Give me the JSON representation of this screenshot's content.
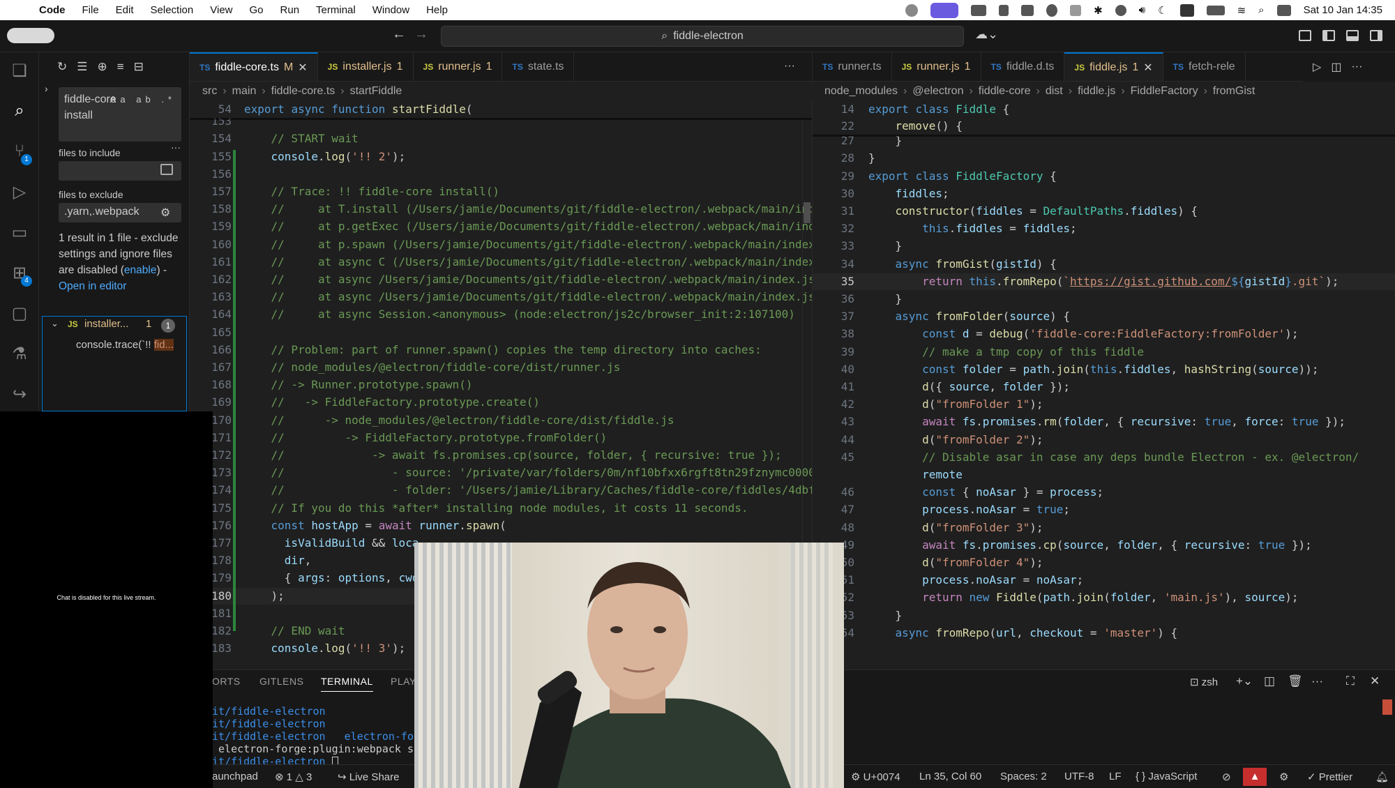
{
  "menubar": {
    "app": "Code",
    "items": [
      "File",
      "Edit",
      "Selection",
      "View",
      "Go",
      "Run",
      "Terminal",
      "Window",
      "Help"
    ],
    "datetime": "Sat 10 Jan  14:35"
  },
  "titlebar": {
    "search": "fiddle-electron"
  },
  "activity": {
    "scm_badge": "1",
    "ext_badge": "4"
  },
  "sidebar": {
    "search_value": "fiddle-core install",
    "search_opts": "Aa ab .*",
    "files_include_label": "files to include",
    "files_exclude_label": "files to exclude",
    "files_exclude_value": ".yarn,.webpack",
    "message": "1 result in 1 file - exclude settings and ignore files are disabled (",
    "message_link": "enable",
    "message_end": ") -",
    "open_in_editor": "Open in editor",
    "result_file": "installer...",
    "result_file_count_inline": "1",
    "result_count": "1",
    "match_prefix": "console.trace(`!! ",
    "match_hl": "fid..."
  },
  "left_editor": {
    "tabs": [
      {
        "icon": "TS",
        "label": "fiddle-core.ts",
        "suffix": "M",
        "active": true
      },
      {
        "icon": "JS",
        "label": "installer.js",
        "suffix": "1"
      },
      {
        "icon": "JS",
        "label": "runner.js",
        "suffix": "1"
      },
      {
        "icon": "TS",
        "label": "state.ts",
        "suffix": ""
      }
    ],
    "breadcrumb": [
      "src",
      "main",
      "fiddle-core.ts",
      "startFiddle"
    ],
    "sticky": {
      "num": "54",
      "text": "export async function startFiddle("
    },
    "lines": [
      {
        "n": "152",
        "t": "    });"
      },
      {
        "n": "153",
        "t": ""
      },
      {
        "n": "154",
        "t": "    // START wait"
      },
      {
        "n": "155",
        "t": "    console.log('!! 2');"
      },
      {
        "n": "156",
        "t": ""
      },
      {
        "n": "157",
        "t": "    // Trace: !! fiddle-core install()"
      },
      {
        "n": "158",
        "t": "    //     at T.install (/Users/jamie/Documents/git/fiddle-electron/.webpack/main/ind"
      },
      {
        "n": "159",
        "t": "    //     at p.getExec (/Users/jamie/Documents/git/fiddle-electron/.webpack/main/ind"
      },
      {
        "n": "160",
        "t": "    //     at p.spawn (/Users/jamie/Documents/git/fiddle-electron/.webpack/main/index"
      },
      {
        "n": "161",
        "t": "    //     at async C (/Users/jamie/Documents/git/fiddle-electron/.webpack/main/index"
      },
      {
        "n": "162",
        "t": "    //     at async /Users/jamie/Documents/git/fiddle-electron/.webpack/main/index.js"
      },
      {
        "n": "163",
        "t": "    //     at async /Users/jamie/Documents/git/fiddle-electron/.webpack/main/index.js"
      },
      {
        "n": "164",
        "t": "    //     at async Session.<anonymous> (node:electron/js2c/browser_init:2:107100)"
      },
      {
        "n": "165",
        "t": ""
      },
      {
        "n": "166",
        "t": "    // Problem: part of runner.spawn() copies the temp directory into caches:"
      },
      {
        "n": "167",
        "t": "    // node_modules/@electron/fiddle-core/dist/runner.js"
      },
      {
        "n": "168",
        "t": "    // -> Runner.prototype.spawn()"
      },
      {
        "n": "169",
        "t": "    //   -> FiddleFactory.prototype.create()"
      },
      {
        "n": "170",
        "t": "    //      -> node_modules/@electron/fiddle-core/dist/fiddle.js"
      },
      {
        "n": "171",
        "t": "    //         -> FiddleFactory.prototype.fromFolder()"
      },
      {
        "n": "172",
        "t": "    //             -> await fs.promises.cp(source, folder, { recursive: true });"
      },
      {
        "n": "173",
        "t": "    //                - source: '/private/var/folders/0m/nf10bfxx6rgft8tn29fznymc0000"
      },
      {
        "n": "174",
        "t": "    //                - folder: '/Users/jamie/Library/Caches/fiddle-core/fiddles/4dbf"
      },
      {
        "n": "175",
        "t": "    // If you do this *after* installing node modules, it costs 11 seconds."
      },
      {
        "n": "176",
        "t": "    const hostApp = await runner.spawn("
      },
      {
        "n": "177",
        "t": "      isValidBuild && loca"
      },
      {
        "n": "178",
        "t": "      dir,"
      },
      {
        "n": "179",
        "t": "      { args: options, cwd"
      },
      {
        "n": "180",
        "t": "    );"
      },
      {
        "n": "181",
        "t": ""
      },
      {
        "n": "182",
        "t": "    // END wait"
      },
      {
        "n": "183",
        "t": "    console.log('!! 3');"
      }
    ]
  },
  "right_editor": {
    "tabs": [
      {
        "icon": "TS",
        "label": "runner.ts",
        "suffix": ""
      },
      {
        "icon": "JS",
        "label": "runner.js",
        "suffix": "1"
      },
      {
        "icon": "TS",
        "label": "fiddle.d.ts",
        "suffix": ""
      },
      {
        "icon": "JS",
        "label": "fiddle.js",
        "suffix": "1",
        "active": true
      },
      {
        "icon": "TS",
        "label": "fetch-rele",
        "suffix": ""
      }
    ],
    "breadcrumb": [
      "node_modules",
      "@electron",
      "fiddle-core",
      "dist",
      "fiddle.js",
      "FiddleFactory",
      "fromGist"
    ],
    "sticky": [
      {
        "num": "14",
        "text": "export class Fiddle {"
      },
      {
        "num": "22",
        "text": "    remove() {"
      }
    ],
    "lines": [
      {
        "n": "26",
        "t": "        });"
      },
      {
        "n": "27",
        "t": "    }"
      },
      {
        "n": "28",
        "t": "}"
      },
      {
        "n": "29",
        "t": "export class FiddleFactory {"
      },
      {
        "n": "30",
        "t": "    fiddles;"
      },
      {
        "n": "31",
        "t": "    constructor(fiddles = DefaultPaths.fiddles) {"
      },
      {
        "n": "32",
        "t": "        this.fiddles = fiddles;"
      },
      {
        "n": "33",
        "t": "    }"
      },
      {
        "n": "34",
        "t": "    async fromGist(gistId) {"
      },
      {
        "n": "35",
        "t": "        return this.fromRepo(`https://gist.github.com/${gistId}.git`);"
      },
      {
        "n": "36",
        "t": "    }"
      },
      {
        "n": "37",
        "t": "    async fromFolder(source) {"
      },
      {
        "n": "38",
        "t": "        const d = debug('fiddle-core:FiddleFactory:fromFolder');"
      },
      {
        "n": "39",
        "t": "        // make a tmp copy of this fiddle"
      },
      {
        "n": "40",
        "t": "        const folder = path.join(this.fiddles, hashString(source));"
      },
      {
        "n": "41",
        "t": "        d({ source, folder });"
      },
      {
        "n": "42",
        "t": "        d(\"fromFolder 1\");"
      },
      {
        "n": "43",
        "t": "        await fs.promises.rm(folder, { recursive: true, force: true });"
      },
      {
        "n": "44",
        "t": "        d(\"fromFolder 2\");"
      },
      {
        "n": "45",
        "t": "        // Disable asar in case any deps bundle Electron - ex. @electron/"
      },
      {
        "n": "",
        "t": "        remote"
      },
      {
        "n": "46",
        "t": "        const { noAsar } = process;"
      },
      {
        "n": "47",
        "t": "        process.noAsar = true;"
      },
      {
        "n": "48",
        "t": "        d(\"fromFolder 3\");"
      },
      {
        "n": "49",
        "t": "        await fs.promises.cp(source, folder, { recursive: true });"
      },
      {
        "n": "50",
        "t": "        d(\"fromFolder 4\");"
      },
      {
        "n": "51",
        "t": "        process.noAsar = noAsar;"
      },
      {
        "n": "52",
        "t": "        return new Fiddle(path.join(folder, 'main.js'), source);"
      },
      {
        "n": "53",
        "t": "    }"
      },
      {
        "n": "54",
        "t": "    async fromRepo(url, checkout = 'master') {"
      }
    ]
  },
  "panel": {
    "tabs": [
      "ORTS",
      "GITLENS",
      "TERMINAL",
      "PLAY"
    ],
    "shell": "zsh",
    "terminal_lines": [
      "it/fiddle-electron",
      "it/fiddle-electron",
      "it/fiddle-electron   electron-for",
      " electron-forge:plugin:webpack st",
      "it/fiddle-electron "
    ]
  },
  "statusbar": {
    "launchpad": "aunchpad",
    "errors": "1",
    "warnings": "3",
    "live_share": "Live Share",
    "char": "U+0074",
    "position": "Ln 35, Col 60",
    "spaces": "Spaces: 2",
    "encoding": "UTF-8",
    "eol": "LF",
    "language": "JavaScript",
    "prettier": "Prettier"
  },
  "chat": {
    "message": "Chat is disabled for this live stream."
  },
  "colors": {
    "accent": "#0078d4",
    "editor_bg": "#1f1f1f",
    "sidebar_bg": "#181818"
  }
}
